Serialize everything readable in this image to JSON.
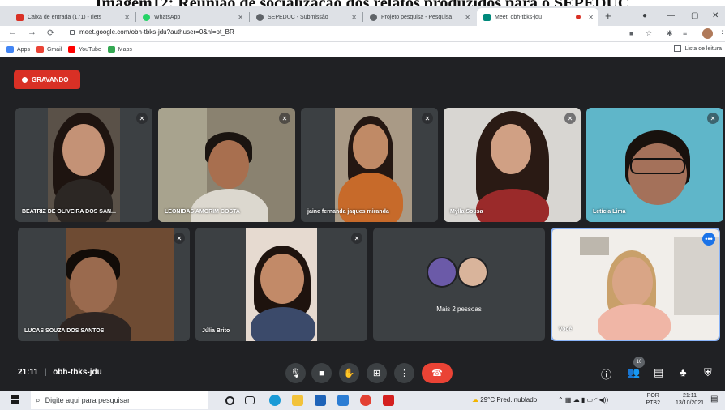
{
  "caption": "Imagem12: Reunião de socialização dos relatos produzidos para o SEPEDUC",
  "browser": {
    "tabs": [
      {
        "label": "Caixa de entrada (171) - rlets",
        "color": "#d93025"
      },
      {
        "label": "WhatsApp",
        "color": "#25d366"
      },
      {
        "label": "SEPEDUC - Submissão",
        "color": "#5f6368"
      },
      {
        "label": "Projeto pesquisa - Pesquisa",
        "color": "#5f6368"
      },
      {
        "label": "Meet: obh-tbks-jdu",
        "color": "#00897b"
      }
    ],
    "url": "meet.google.com/obh-tbks-jdu?authuser=0&hl=pt_BR",
    "bookmarks": [
      {
        "label": "Apps",
        "color": "#4285f4"
      },
      {
        "label": "Gmail",
        "color": "#ea4335"
      },
      {
        "label": "YouTube",
        "color": "#ff0000"
      },
      {
        "label": "Maps",
        "color": "#34a853"
      }
    ],
    "reading_list": "Lista de leitura"
  },
  "meet": {
    "recording_label": "GRAVANDO",
    "participants": [
      {
        "name": "BEATRIZ DE OLIVEIRA DOS SAN...",
        "bg": "#5a5148",
        "skin": "#c49276",
        "hair": "#1e1410"
      },
      {
        "name": "LEONIDAS AMORIM COSTA",
        "bg": "#8a8270",
        "skin": "#a86f4f",
        "hair": "#1a1410"
      },
      {
        "name": "jaine fernanda jaques miranda",
        "bg": "#a99a86",
        "skin": "#c08a66",
        "hair": "#241712"
      },
      {
        "name": "Mylla Sousa",
        "bg": "#d8d6d2",
        "skin": "#d0a084",
        "hair": "#2a1a14"
      },
      {
        "name": "Letícia Lima",
        "bg": "#5fb6c9",
        "skin": "#a4715a",
        "hair": "#18110d"
      },
      {
        "name": "LUCAS SOUZA DOS SANTOS",
        "bg": "#6e4b33",
        "skin": "#9a6a4e",
        "hair": "#120c08"
      },
      {
        "name": "Júlia Brito",
        "bg": "#e6dad0",
        "skin": "#c28a68",
        "hair": "#1e130e"
      }
    ],
    "more_people_label": "Mais 2 pessoas",
    "self_label": "Você",
    "meeting_time": "21:11",
    "meeting_code": "obh-tbks-jdu",
    "participant_count": "10"
  },
  "taskbar": {
    "search_placeholder": "Digite aqui para pesquisar",
    "weather": "29°C  Pred. nublado",
    "lang_top": "POR",
    "lang_bottom": "PTB2",
    "time": "21:11",
    "date": "13/10/2021"
  }
}
